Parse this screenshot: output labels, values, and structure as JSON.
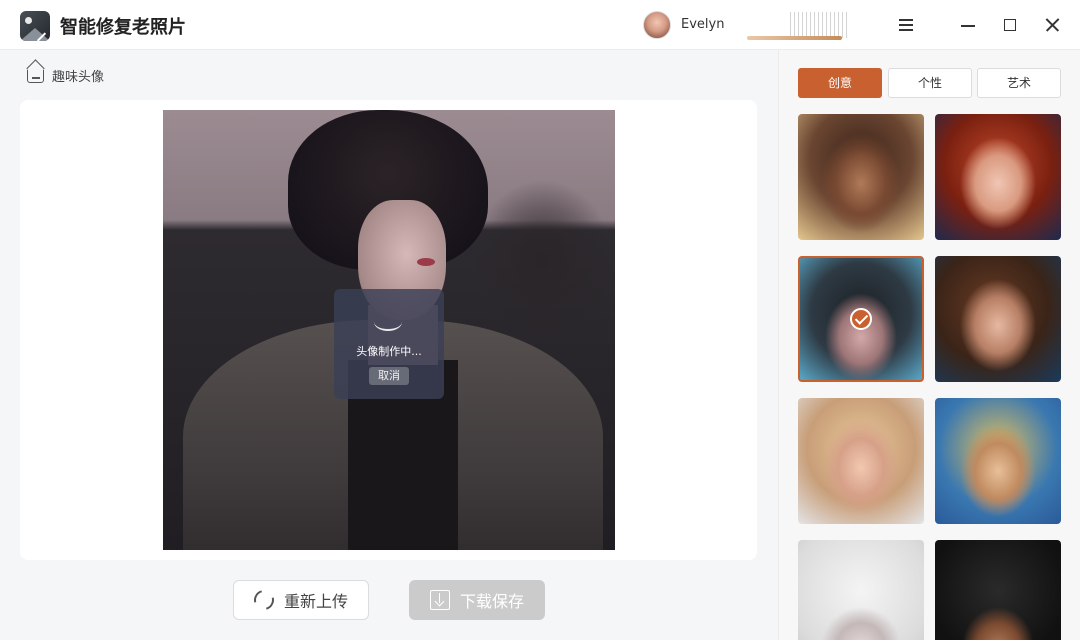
{
  "app": {
    "title": "智能修复老照片",
    "user_name": "Evelyn"
  },
  "window_controls": [
    "menu-icon",
    "minimize-icon",
    "maximize-icon",
    "close-icon"
  ],
  "breadcrumb": {
    "icon": "home-icon",
    "label": "趣味头像"
  },
  "canvas": {
    "loading_text": "头像制作中...",
    "cancel_label": "取消"
  },
  "actions": {
    "reupload_label": "重新上传",
    "reupload_icon": "refresh-icon",
    "download_label": "下载保存",
    "download_icon": "download-icon"
  },
  "side_panel": {
    "tabs": [
      {
        "label": "创意",
        "active": true
      },
      {
        "label": "个性",
        "active": false
      },
      {
        "label": "艺术",
        "active": false
      }
    ],
    "selected_thumbnail": 3,
    "thumbnail_count": 8
  },
  "colors": {
    "accent": "#c8602f",
    "download_disabled": "#cbcbcb",
    "loading_overlay": "#3a4056"
  }
}
